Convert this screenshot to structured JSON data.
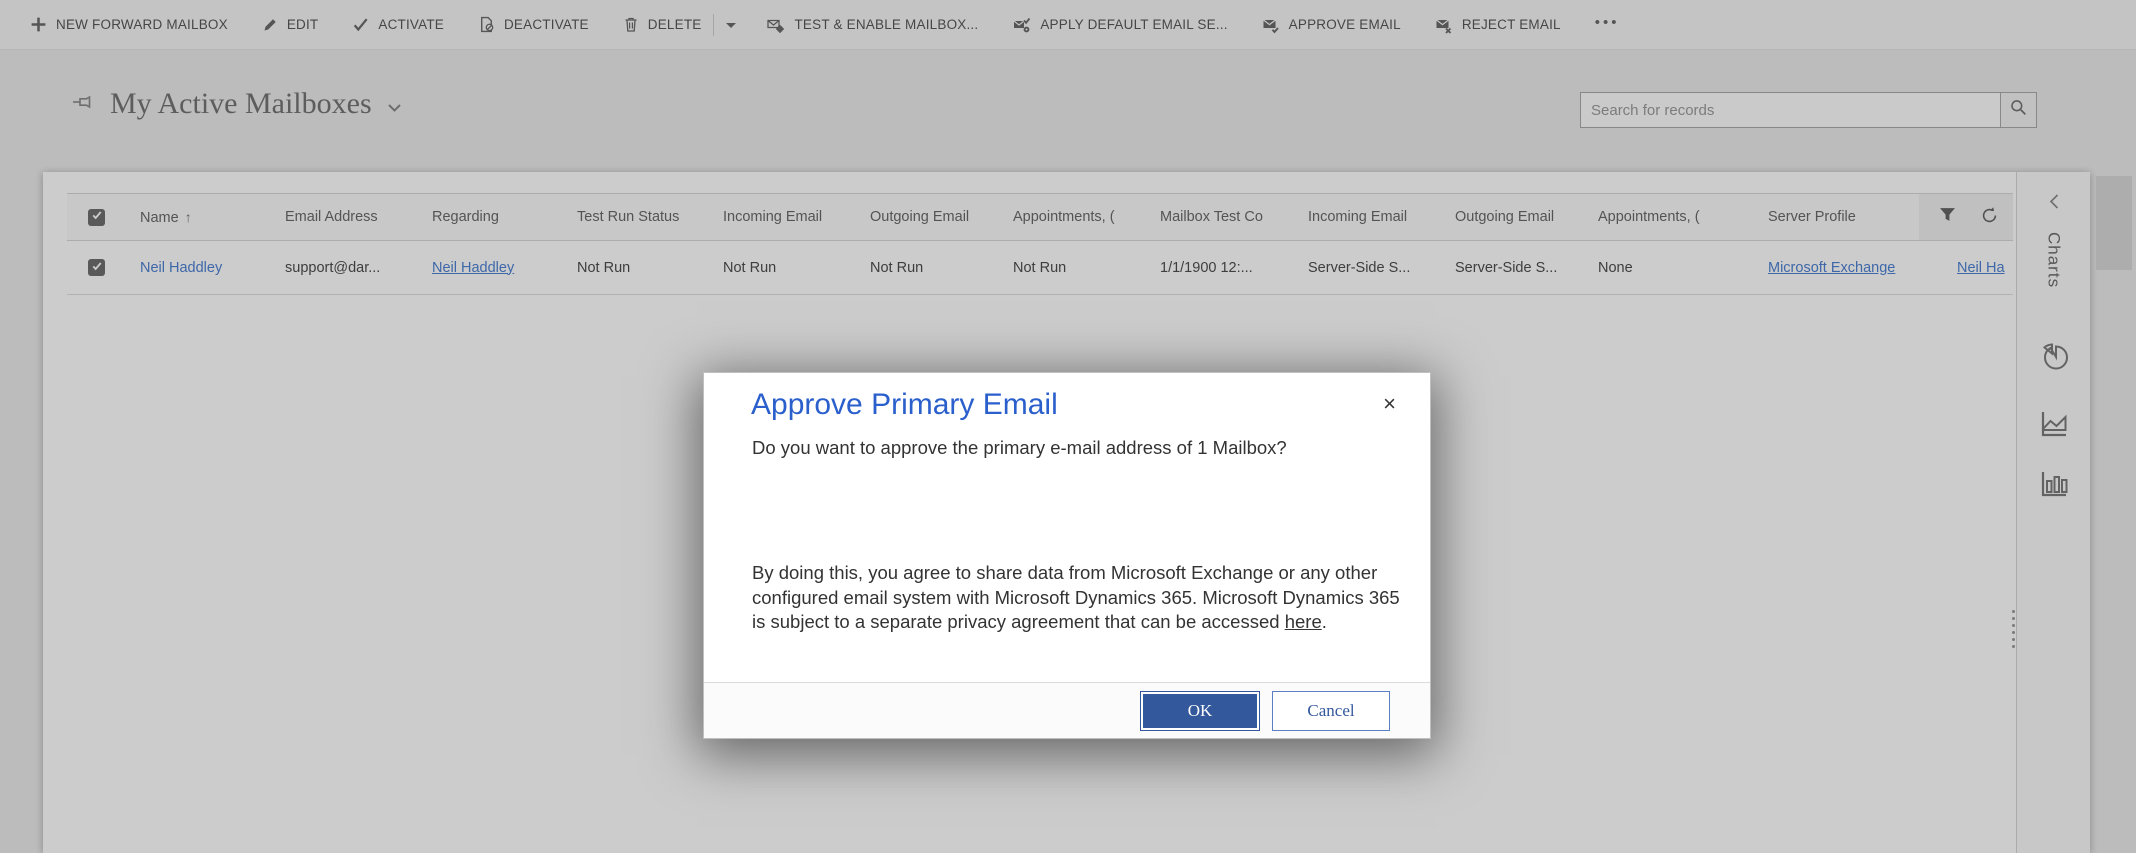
{
  "toolbar": {
    "items": [
      {
        "label": "NEW FORWARD MAILBOX",
        "icon": "plus-icon"
      },
      {
        "label": "EDIT",
        "icon": "pencil-icon"
      },
      {
        "label": "ACTIVATE",
        "icon": "check-icon"
      },
      {
        "label": "DEACTIVATE",
        "icon": "deactivate-icon"
      },
      {
        "label": "DELETE",
        "icon": "trash-icon"
      },
      {
        "label": "TEST & ENABLE MAILBOX...",
        "icon": "test-enable-mailbox-icon"
      },
      {
        "label": "APPLY DEFAULT EMAIL SE...",
        "icon": "apply-default-email-settings-icon"
      },
      {
        "label": "APPROVE EMAIL",
        "icon": "approve-email-icon"
      },
      {
        "label": "REJECT EMAIL",
        "icon": "reject-email-icon"
      }
    ],
    "more_label": "•••"
  },
  "view": {
    "title": "My Active Mailboxes"
  },
  "search": {
    "placeholder": "Search for records"
  },
  "grid": {
    "sort_indicator": "↑",
    "select_all_checked": true,
    "columns": [
      {
        "label": "Name"
      },
      {
        "label": "Email Address"
      },
      {
        "label": "Regarding"
      },
      {
        "label": "Test Run Status"
      },
      {
        "label": "Incoming Email"
      },
      {
        "label": "Outgoing Email"
      },
      {
        "label": "Appointments, ("
      },
      {
        "label": "Mailbox Test Co"
      },
      {
        "label": "Incoming Email"
      },
      {
        "label": "Outgoing Email"
      },
      {
        "label": "Appointments, ("
      },
      {
        "label": "Server Profile"
      }
    ],
    "row": {
      "selected": true,
      "name": "Neil Haddley",
      "email_address": "support@dar...",
      "regarding": "Neil Haddley",
      "test_run_status": "Not Run",
      "incoming_email": "Not Run",
      "outgoing_email": "Not Run",
      "appointments": "Not Run",
      "mailbox_test_co": "1/1/1900 12:...",
      "incoming_email_2": "Server-Side S...",
      "outgoing_email_2": "Server-Side S...",
      "appointments_2": "None",
      "server_profile": "Microsoft Exchange",
      "owner": "Neil Ha"
    }
  },
  "charts_rail": {
    "label": "Charts"
  },
  "dialog": {
    "title": "Approve Primary Email",
    "close_label": "×",
    "message": "Do you want to approve the primary e-mail address of 1 Mailbox?",
    "body_before_link": "By doing this, you agree to share data from Microsoft Exchange or any other configured email system with Microsoft Dynamics 365. Microsoft Dynamics 365 is subject to a separate privacy agreement that can be accessed ",
    "link_text": "here",
    "body_after_link": ".",
    "ok_label": "OK",
    "cancel_label": "Cancel"
  },
  "colors": {
    "dialog_title_blue": "#2A5FCC",
    "ok_button_blue": "#34589C",
    "link_blue": "#4E82D4"
  }
}
